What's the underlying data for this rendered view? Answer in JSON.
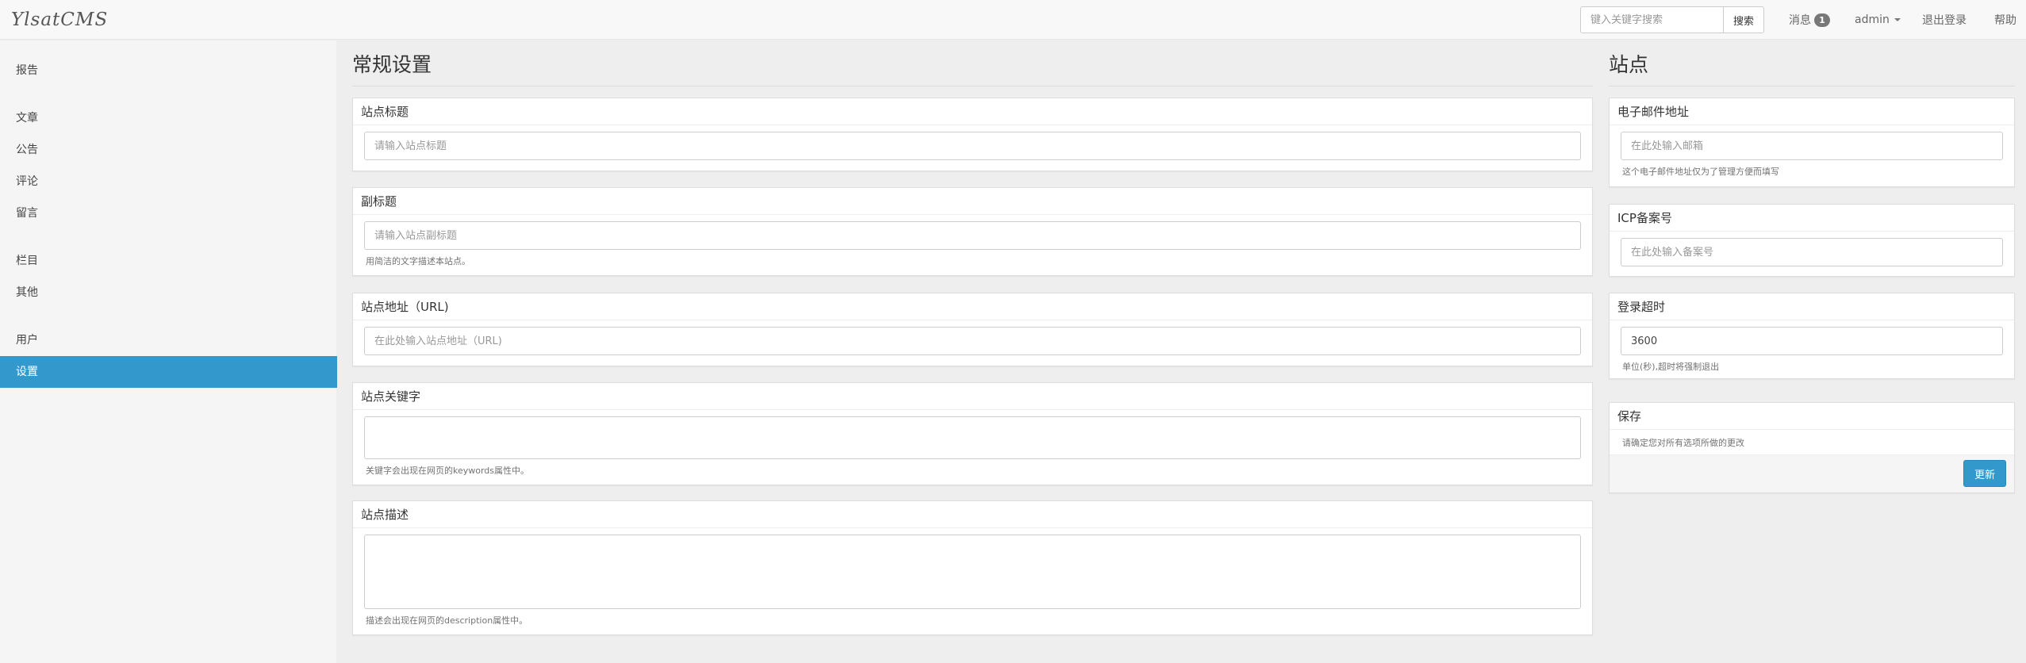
{
  "app": {
    "brand": "YlsatCMS"
  },
  "header": {
    "search_placeholder": "键入关键字搜索",
    "search_button": "搜索",
    "messages_label": "消息",
    "messages_count": "1",
    "user_label": "admin",
    "logout_label": "退出登录",
    "help_label": "帮助"
  },
  "sidebar": {
    "items": [
      {
        "label": "报告"
      },
      {
        "label": "文章"
      },
      {
        "label": "公告"
      },
      {
        "label": "评论"
      },
      {
        "label": "留言"
      },
      {
        "label": "栏目"
      },
      {
        "label": "其他"
      },
      {
        "label": "用户"
      },
      {
        "label": "设置"
      }
    ],
    "active_item": "设置",
    "active_color": "#3399cc"
  },
  "general": {
    "title": "常规设置",
    "site_title": {
      "label": "站点标题",
      "placeholder": "请输入站点标题",
      "value": ""
    },
    "subtitle": {
      "label": "副标题",
      "placeholder": "请输入站点副标题",
      "value": "",
      "help": "用简洁的文字描述本站点。"
    },
    "site_url": {
      "label": "站点地址（URL)",
      "placeholder": "在此处输入站点地址（URL)",
      "value": ""
    },
    "keywords": {
      "label": "站点关键字",
      "value": "",
      "help": "关键字会出现在网页的keywords属性中。"
    },
    "description": {
      "label": "站点描述",
      "value": "",
      "help": "描述会出现在网页的description属性中。"
    }
  },
  "site": {
    "title": "站点",
    "email": {
      "label": "电子邮件地址",
      "placeholder": "在此处输入邮箱",
      "value": "",
      "help": "这个电子邮件地址仅为了管理方便而填写"
    },
    "icp": {
      "label": "ICP备案号",
      "placeholder": "在此处输入备案号",
      "value": ""
    },
    "login_timeout": {
      "label": "登录超时",
      "value": "3600",
      "help": "单位(秒),超时将强制退出"
    },
    "save": {
      "label": "保存",
      "help": "请确定您对所有选项所做的更改",
      "button": "更新",
      "button_color": "#3399cc"
    }
  }
}
